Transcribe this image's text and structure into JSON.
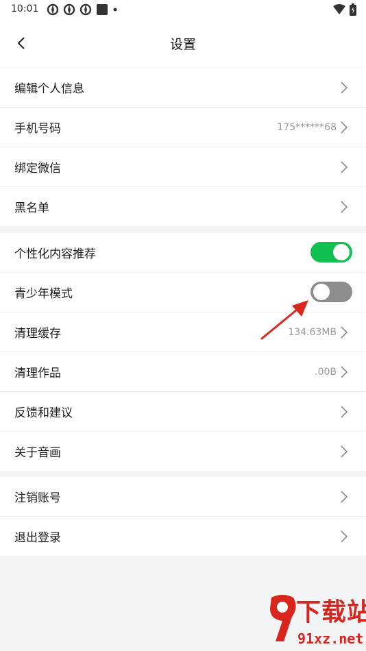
{
  "status_bar": {
    "time": "10:01"
  },
  "header": {
    "title": "设置"
  },
  "groups": [
    {
      "items": [
        {
          "label": "编辑个人信息",
          "value": ""
        },
        {
          "label": "手机号码",
          "value": "175******68"
        },
        {
          "label": "绑定微信",
          "value": ""
        },
        {
          "label": "黑名单",
          "value": ""
        }
      ]
    },
    {
      "items": [
        {
          "label": "个性化内容推荐",
          "toggle": true
        },
        {
          "label": "青少年模式",
          "toggle": false
        },
        {
          "label": "清理缓存",
          "value": "134.63MB"
        },
        {
          "label": "清理作品",
          "value": ".00B"
        },
        {
          "label": "反馈和建议",
          "value": ""
        },
        {
          "label": "关于音画",
          "value": ""
        }
      ]
    },
    {
      "items": [
        {
          "label": "注销账号",
          "value": ""
        },
        {
          "label": "退出登录",
          "value": ""
        }
      ]
    }
  ],
  "colors": {
    "toggle_on": "#12c04f",
    "toggle_off": "#8d8d8d",
    "annotation_arrow": "#d8261f"
  },
  "watermark": {
    "line1": "下载站",
    "line2": "91xz.net"
  }
}
